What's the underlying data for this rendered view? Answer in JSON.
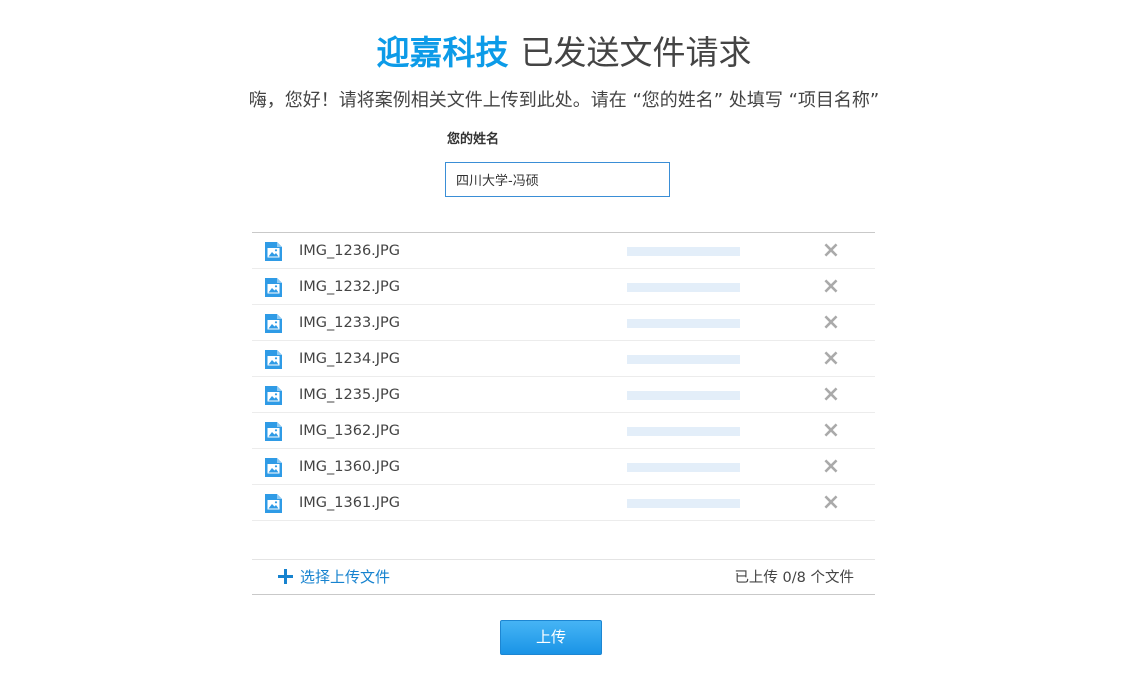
{
  "header": {
    "brand": "迎嘉科技",
    "title_rest": "已发送文件请求"
  },
  "subtitle": "嗨，您好！请将案例相关文件上传到此处。请在 “您的姓名” 处填写 “项目名称”",
  "name_field": {
    "label": "您的姓名",
    "value": "四川大学-冯硕"
  },
  "files": [
    {
      "name": "IMG_1236.JPG",
      "progress": 0
    },
    {
      "name": "IMG_1232.JPG",
      "progress": 0
    },
    {
      "name": "IMG_1233.JPG",
      "progress": 0
    },
    {
      "name": "IMG_1234.JPG",
      "progress": 0
    },
    {
      "name": "IMG_1235.JPG",
      "progress": 0
    },
    {
      "name": "IMG_1362.JPG",
      "progress": 0
    },
    {
      "name": "IMG_1360.JPG",
      "progress": 0
    },
    {
      "name": "IMG_1361.JPG",
      "progress": 0
    }
  ],
  "icons": {
    "file": "image-file-icon",
    "remove": "close-icon",
    "add": "plus-icon"
  },
  "footer": {
    "add_label": "选择上传文件",
    "status": "已上传 0/8 个文件"
  },
  "upload_button": "上传",
  "colors": {
    "brand": "#0c9be8",
    "link": "#1783cf",
    "progress_track": "#e3eef9"
  }
}
